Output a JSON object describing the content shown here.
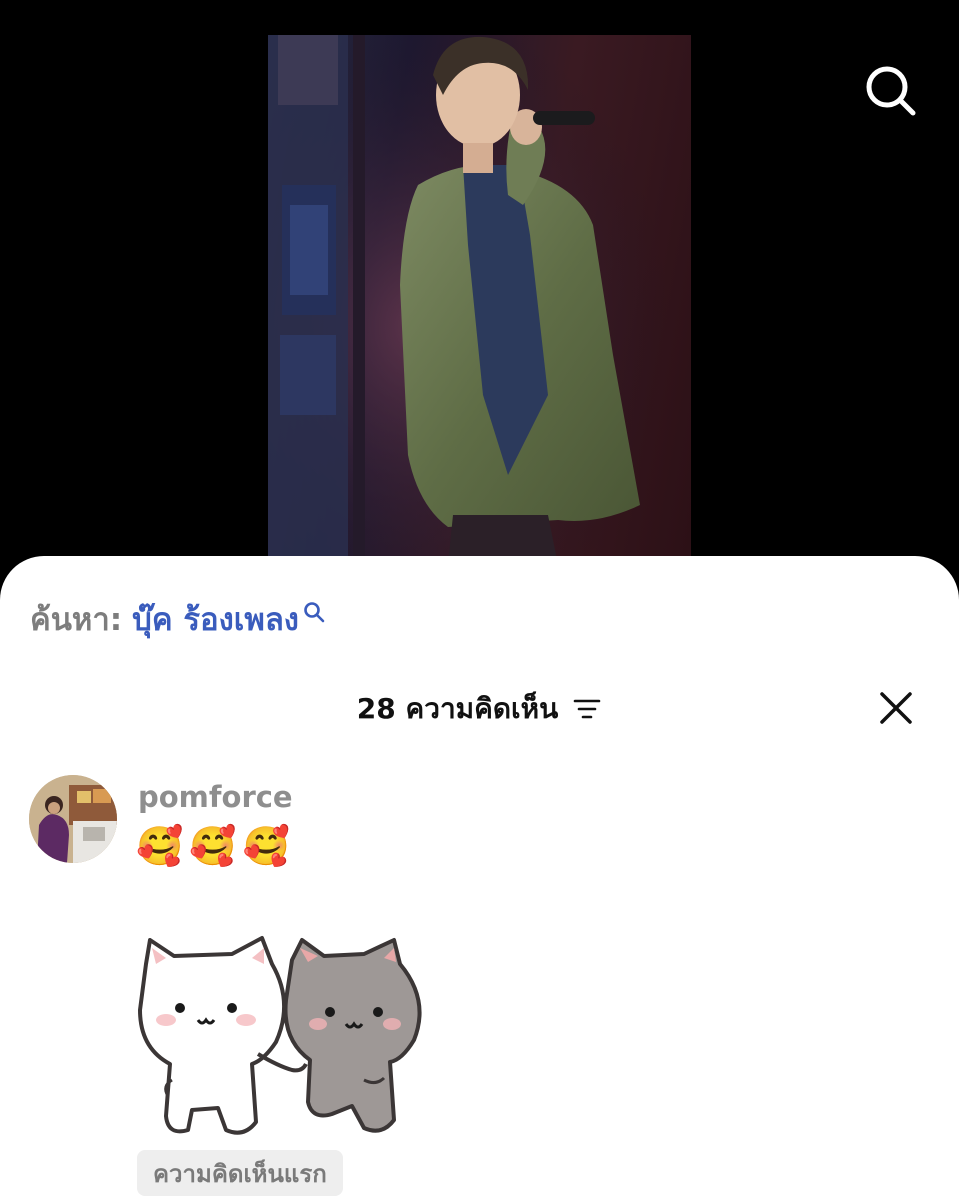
{
  "video": {
    "search_icon": "search-icon"
  },
  "search_suggestion": {
    "prefix": "ค้นหา:",
    "term": "บุ๊ค ร้องเพลง",
    "icon": "search-icon"
  },
  "comments": {
    "title": "28 ความคิดเห็น",
    "sort_icon": "sort-lines-icon",
    "close_icon": "close-icon",
    "items": [
      {
        "username": "pomforce",
        "text": "🥰🥰🥰",
        "sticker": "two-cats-holding-hands-sticker",
        "badge": "ความคิดเห็นแรก"
      }
    ]
  },
  "colors": {
    "sheet_bg": "#ffffff",
    "screen_bg": "#000000",
    "search_term": "#3a5cbd",
    "muted": "#8e8e8e",
    "badge_bg": "#eeeeee"
  }
}
